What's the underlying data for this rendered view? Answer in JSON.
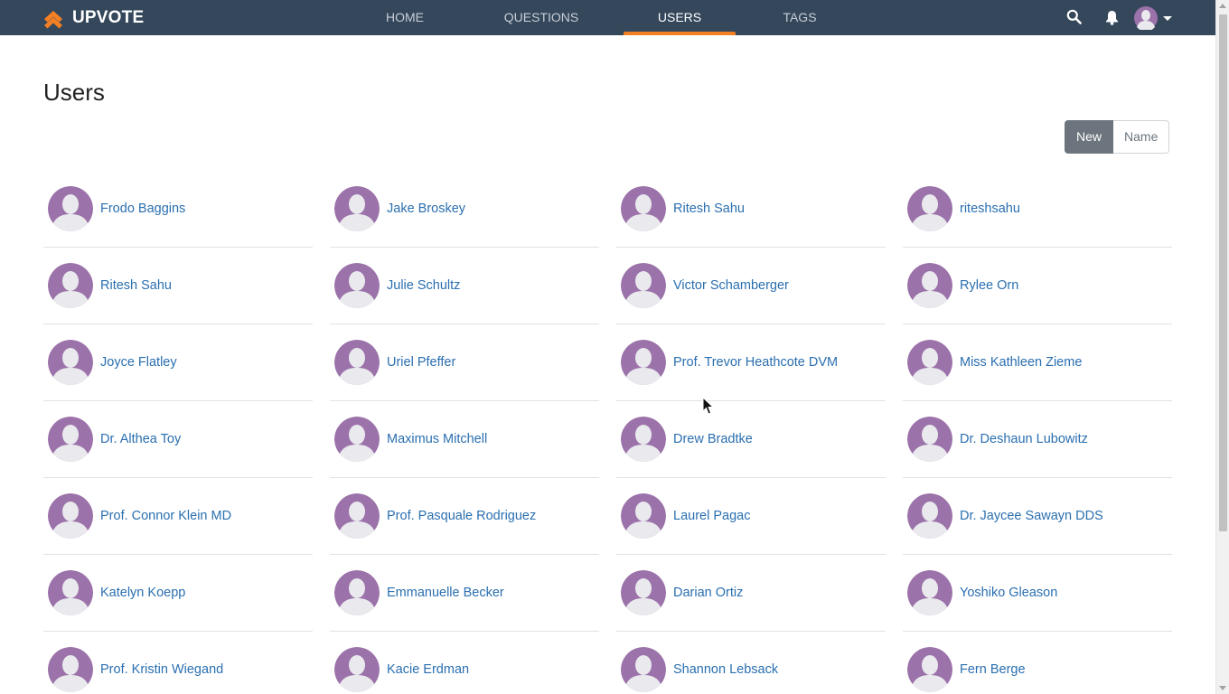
{
  "brand": {
    "name": "UPVOTE",
    "logo_icon": "double-chevron-up-icon",
    "accent_color": "#f48024"
  },
  "nav": {
    "items": [
      {
        "label": "HOME",
        "active": false
      },
      {
        "label": "QUESTIONS",
        "active": false
      },
      {
        "label": "USERS",
        "active": true
      },
      {
        "label": "TAGS",
        "active": false
      }
    ],
    "icons": [
      "search-icon",
      "bell-icon",
      "avatar",
      "chevron-down-icon"
    ],
    "bar_color": "#34475b"
  },
  "page": {
    "title": "Users"
  },
  "sort": {
    "options": [
      "New",
      "Name"
    ],
    "selected": "New"
  },
  "users": [
    "Frodo Baggins",
    "Jake Broskey",
    "Ritesh Sahu",
    "riteshsahu",
    "Ritesh Sahu",
    "Julie Schultz",
    "Victor Schamberger",
    "Rylee Orn",
    "Joyce Flatley",
    "Uriel Pfeffer",
    "Prof. Trevor Heathcote DVM",
    "Miss Kathleen Zieme",
    "Dr. Althea Toy",
    "Maximus Mitchell",
    "Drew Bradtke",
    "Dr. Deshaun Lubowitz",
    "Prof. Connor Klein MD",
    "Prof. Pasquale Rodriguez",
    "Laurel Pagac",
    "Dr. Jaycee Sawayn DDS",
    "Katelyn Koepp",
    "Emmanuelle Becker",
    "Darian Ortiz",
    "Yoshiko Gleason",
    "Prof. Kristin Wiegand",
    "Kacie Erdman",
    "Shannon Lebsack",
    "Fern Berge"
  ],
  "avatar_color": "#9b72a9",
  "link_color": "#2a6fb0"
}
